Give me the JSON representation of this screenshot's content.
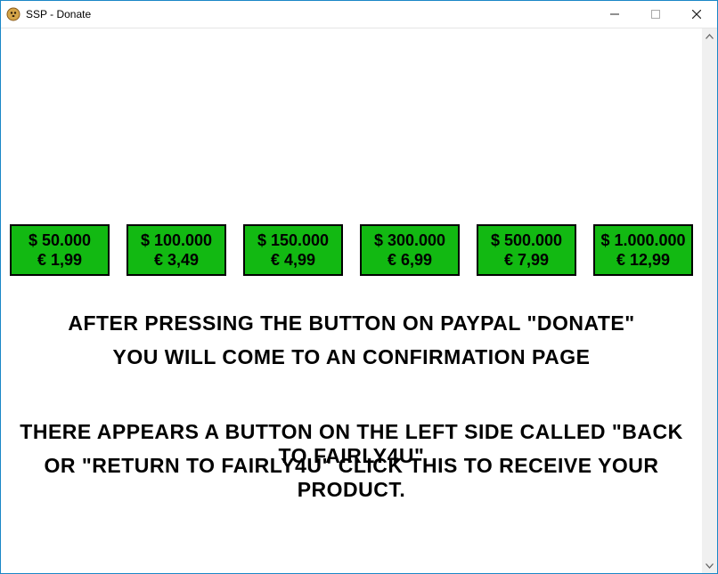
{
  "window": {
    "title": "SSP - Donate"
  },
  "buttons": [
    {
      "dollar": "$ 50.000",
      "euro": "€ 1,99"
    },
    {
      "dollar": "$ 100.000",
      "euro": "€ 3,49"
    },
    {
      "dollar": "$ 150.000",
      "euro": "€ 4,99"
    },
    {
      "dollar": "$ 300.000",
      "euro": "€ 6,99"
    },
    {
      "dollar": "$ 500.000",
      "euro": "€ 7,99"
    },
    {
      "dollar": "$ 1.000.000",
      "euro": "€ 12,99"
    }
  ],
  "info": {
    "line1": "After pressing the button on Paypal \"Donate\"",
    "line2": "you will come to an confirmation page",
    "line3": "There appears a button on the left side called \"Back to Fairly4u\"",
    "line4": "or \"Return to Fairly4u\" click this to receive your product."
  }
}
